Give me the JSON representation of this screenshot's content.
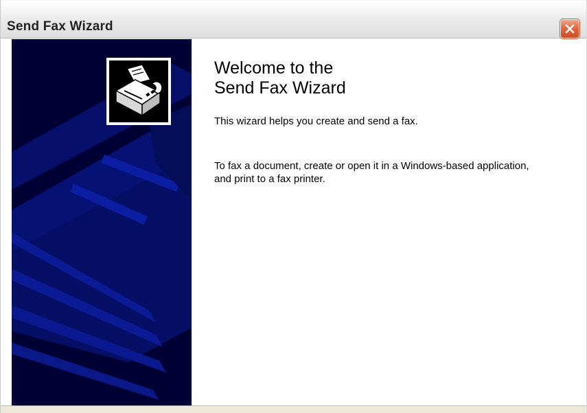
{
  "window": {
    "title": "Send Fax Wizard"
  },
  "titlebar": {
    "close_icon": "close-icon"
  },
  "side_panel": {
    "icon": "fax-machine-icon"
  },
  "content": {
    "heading_line1": "Welcome to the",
    "heading_line2": "Send Fax Wizard",
    "paragraph1": "This wizard helps you create and send a fax.",
    "paragraph2": "To fax a document, create or open it in a Windows-based application, and print to a fax printer."
  },
  "colors": {
    "side_panel_bg": "#000034",
    "side_panel_stripes": "#08147a",
    "close_button": "#d9582f"
  }
}
